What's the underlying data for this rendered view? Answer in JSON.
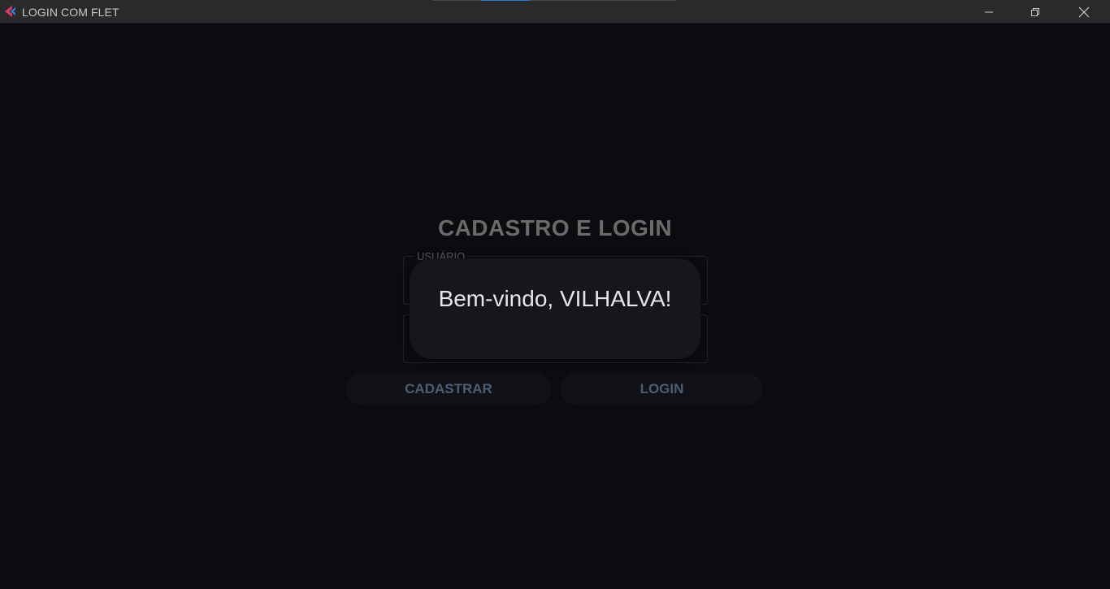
{
  "window": {
    "title": "LOGIN COM FLET",
    "controls": {
      "minimize_icon": "minimize-icon",
      "maximize_icon": "restore-icon",
      "close_icon": "close-icon"
    }
  },
  "form": {
    "title": "CADASTRO E LOGIN",
    "username_label": "USUÁRIO",
    "username_value": "",
    "password_value": "",
    "buttons": {
      "register": "CADASTRAR",
      "login": "LOGIN"
    }
  },
  "dialog": {
    "message": "Bem-vindo, VILHALVA!"
  },
  "colors": {
    "background": "#0b0c0f",
    "titlebar": "#2a2a2c",
    "dialog": "#15171c",
    "button_text": "#4b5e78",
    "accent": "#2f76d2"
  }
}
